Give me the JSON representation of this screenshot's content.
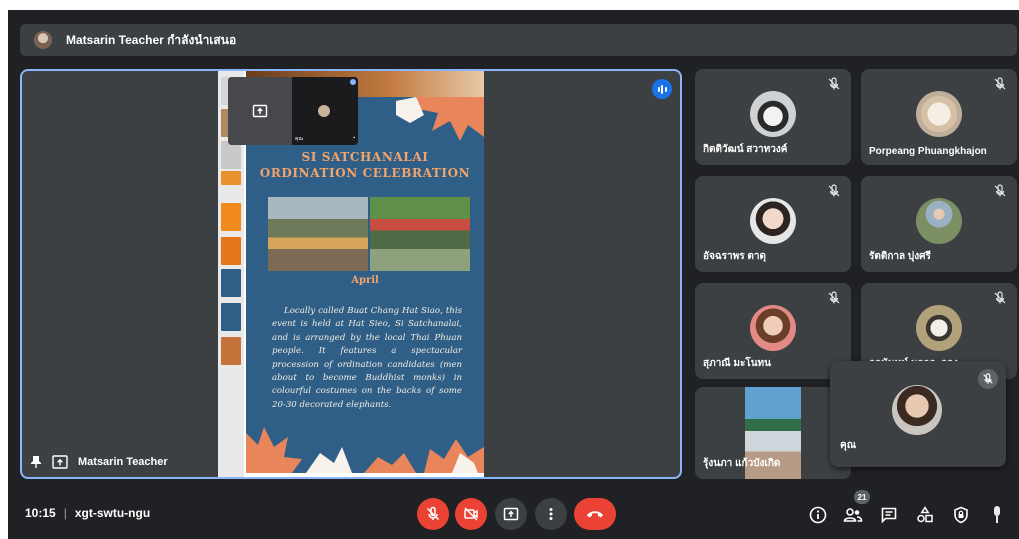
{
  "banner": {
    "presenter_text": "Matsarin Teacher กำลังนำเสนอ"
  },
  "main": {
    "presenter_name": "Matsarin Teacher",
    "slide": {
      "title_line1": "SI SATCHANALAI",
      "title_line2": "ORDINATION CELEBRATION",
      "month": "April",
      "body": "Locally called Buat Chang Hat Siao, this event is held at Hat Sieo, Si Satchanalai, and is arranged by the local Thai Phuan people. It features a spectacular procession of ordination candidates (men about to become Buddhist monks) in colourful costumes on the backs of some 20-30 decorated elephants."
    },
    "self_preview": {
      "name": "คุณ"
    }
  },
  "participants": [
    {
      "name": "กิตติวัฒน์ สวาทวงค์",
      "avatar_color": "#cfd2d4"
    },
    {
      "name": "Porpeang Phuangkhajon",
      "avatar_color": "#e6d6c2"
    },
    {
      "name": "อัจฉราพร ตาดุ",
      "avatar_color": "#d9c2b0"
    },
    {
      "name": "รัตติกาล บุ่งศรี",
      "avatar_color": "#8c9d7a"
    },
    {
      "name": "สุภาณี มะโนทน",
      "avatar_color": "#c9a07e"
    },
    {
      "name": "กลนันทน์ นวลละออง",
      "avatar_color": "#a9a49a"
    },
    {
      "name": "รุ้งนภา แก้วบังเกิด",
      "avatar_color": "#6fa3c7"
    }
  ],
  "pip": {
    "name": "คุณ"
  },
  "bottom": {
    "time": "10:15",
    "separator": "|",
    "meeting_code": "xgt-swtu-ngu",
    "participant_count": "21"
  },
  "colors": {
    "accent": "#8ab4f8",
    "danger": "#ea4335",
    "surface": "#3c4043",
    "background": "#202124"
  }
}
